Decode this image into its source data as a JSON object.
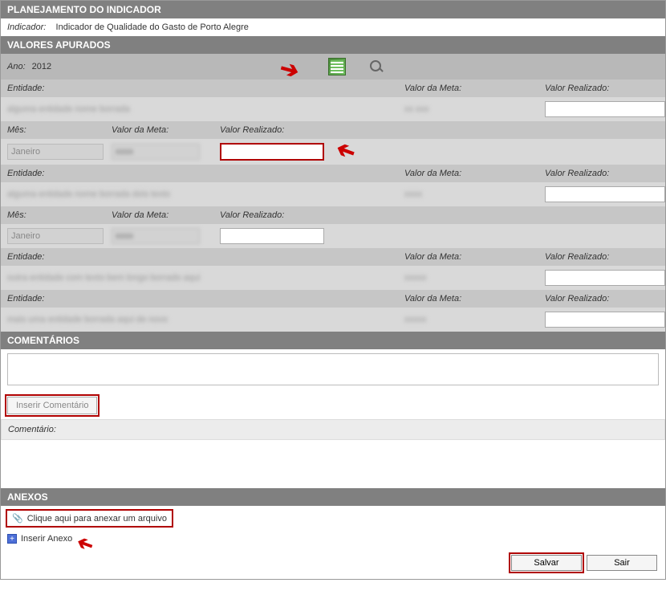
{
  "section_planejamento": {
    "title": "PLANEJAMENTO DO INDICADOR",
    "indicador_label": "Indicador:",
    "indicador_value": "Indicador de Qualidade do Gasto de Porto Alegre"
  },
  "section_valores": {
    "title": "VALORES APURADOS",
    "ano_label": "Ano:",
    "ano_value": "2012",
    "headers": {
      "entidade": "Entidade:",
      "valor_meta": "Valor da Meta:",
      "valor_realizado": "Valor Realizado:",
      "mes": "Mês:"
    },
    "entries": [
      {
        "entidade_blur": "alguma entidade nome borrada",
        "valor_meta_blur": "xx xxx",
        "valor_realizado": "",
        "has_month": true,
        "mes": "Janeiro",
        "month_meta_blur": "xxxx",
        "month_realizado": "",
        "highlight_realizado": true
      },
      {
        "entidade_blur": "alguma entidade nome borrada dois texto",
        "valor_meta_blur": "xxxx",
        "valor_realizado": "",
        "has_month": true,
        "mes": "Janeiro",
        "month_meta_blur": "xxxx",
        "month_realizado": "",
        "highlight_realizado": false
      },
      {
        "entidade_blur": "outra entidade com texto bem longo borrado aqui",
        "valor_meta_blur": "xxxxx",
        "valor_realizado": ""
      },
      {
        "entidade_blur": "mais uma entidade borrada aqui de novo",
        "valor_meta_blur": "xxxxx",
        "valor_realizado": ""
      }
    ]
  },
  "section_comentarios": {
    "title": "COMENTÁRIOS",
    "inserir_btn": "Inserir Comentário",
    "label": "Comentário:"
  },
  "section_anexos": {
    "title": "ANEXOS",
    "clique_link": "Clique aqui para anexar um arquivo",
    "inserir_link": "Inserir Anexo"
  },
  "buttons": {
    "salvar": "Salvar",
    "sair": "Sair"
  }
}
